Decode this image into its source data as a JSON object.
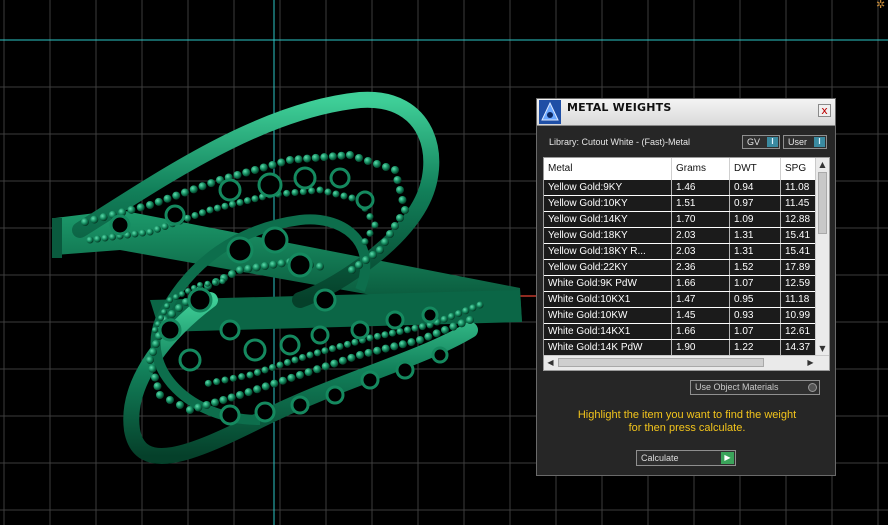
{
  "panel": {
    "title": "METAL WEIGHTS",
    "close_label": "x",
    "library_label": "Library: Cutout White - (Fast)-Metal",
    "gv_label": "GV",
    "user_label": "User",
    "toggle_glyph": "I",
    "columns": [
      "Metal",
      "Grams",
      "DWT",
      "SPG"
    ],
    "rows": [
      {
        "metal": "Yellow Gold:9KY",
        "grams": "1.46",
        "dwt": "0.94",
        "spg": "11.08"
      },
      {
        "metal": "Yellow Gold:10KY",
        "grams": "1.51",
        "dwt": "0.97",
        "spg": "11.45"
      },
      {
        "metal": "Yellow Gold:14KY",
        "grams": "1.70",
        "dwt": "1.09",
        "spg": "12.88"
      },
      {
        "metal": "Yellow Gold:18KY",
        "grams": "2.03",
        "dwt": "1.31",
        "spg": "15.41"
      },
      {
        "metal": "Yellow Gold:18KY R...",
        "grams": "2.03",
        "dwt": "1.31",
        "spg": "15.41"
      },
      {
        "metal": "Yellow Gold:22KY",
        "grams": "2.36",
        "dwt": "1.52",
        "spg": "17.89"
      },
      {
        "metal": "White Gold:9K PdW",
        "grams": "1.66",
        "dwt": "1.07",
        "spg": "12.59"
      },
      {
        "metal": "White Gold:10KX1",
        "grams": "1.47",
        "dwt": "0.95",
        "spg": "11.18"
      },
      {
        "metal": "White Gold:10KW",
        "grams": "1.45",
        "dwt": "0.93",
        "spg": "10.99"
      },
      {
        "metal": "White Gold:14KX1",
        "grams": "1.66",
        "dwt": "1.07",
        "spg": "12.61"
      },
      {
        "metal": "White Gold:14K PdW",
        "grams": "1.90",
        "dwt": "1.22",
        "spg": "14.37"
      }
    ],
    "use_object_materials_label": "Use Object Materials",
    "hint_line1": "Highlight the item you want to find the weight",
    "hint_line2": "for then press calculate.",
    "calculate_label": "Calculate",
    "colors": {
      "accent_hint": "#f2c41c",
      "ring_green": "#0f7a56",
      "axis_cyan": "#2cc6c6"
    }
  }
}
